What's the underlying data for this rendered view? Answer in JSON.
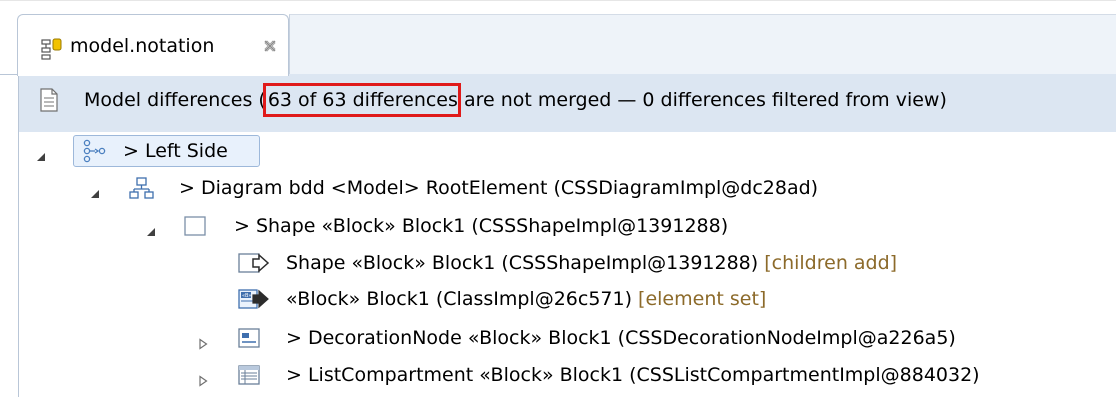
{
  "editor_tab": {
    "title": "model.notation",
    "icon": "model-file-icon",
    "close_icon": "close-icon"
  },
  "header": {
    "icon": "document-icon",
    "prefix": "Model differences (",
    "highlighted": "63 of 63 differences",
    "suffix": " are not merged — 0 differences filtered from view)",
    "highlight_color": "#e01a1a"
  },
  "tree": {
    "rows": [
      {
        "label": "> Left Side",
        "suffix": "",
        "twisty": "expanded",
        "icon": "match-resource-icon"
      },
      {
        "label": "> Diagram bdd <Model> RootElement (CSSDiagramImpl@dc28ad)",
        "suffix": "",
        "twisty": "expanded",
        "icon": "diagram-icon"
      },
      {
        "label": "> Shape «Block» Block1 (CSSShapeImpl@1391288)",
        "suffix": "",
        "twisty": "expanded",
        "icon": "shape-icon"
      },
      {
        "label": "Shape «Block» Block1 (CSSShapeImpl@1391288)",
        "suffix": " [children add]",
        "twisty": "none",
        "icon": "add-shape-icon"
      },
      {
        "label": "«Block» Block1 (ClassImpl@26c571)",
        "suffix": " [element set]",
        "twisty": "none",
        "icon": "set-element-icon"
      },
      {
        "label": "> DecorationNode «Block» Block1 (CSSDecorationNodeImpl@a226a5)",
        "suffix": "",
        "twisty": "collapsed",
        "icon": "decoration-node-icon"
      },
      {
        "label": "> ListCompartment «Block» Block1 (CSSListCompartmentImpl@884032)",
        "suffix": "",
        "twisty": "collapsed",
        "icon": "list-compartment-icon"
      }
    ]
  }
}
